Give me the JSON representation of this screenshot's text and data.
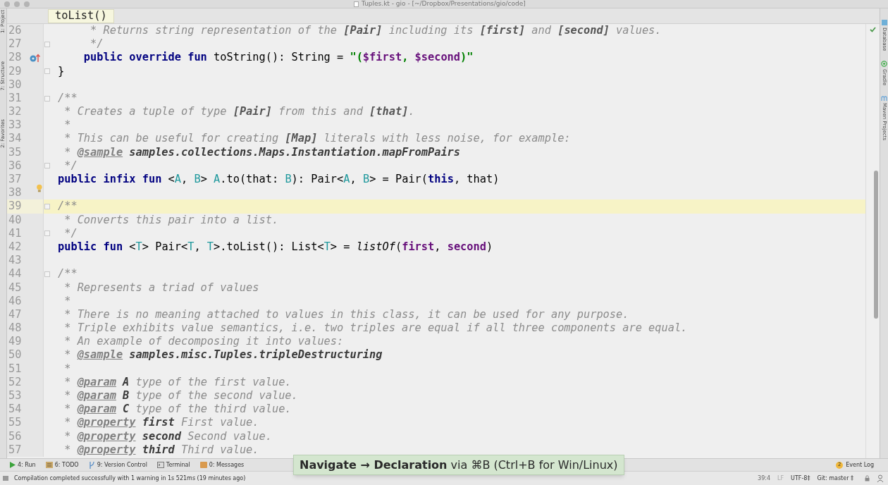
{
  "window": {
    "title": "Tuples.kt - gio - [~/Dropbox/Presentations/gio/code]"
  },
  "breadcrumb": {
    "label": "toList()"
  },
  "left_stripe": [
    {
      "label": "1: Project"
    },
    {
      "label": "7: Structure"
    },
    {
      "label": "2: Favorites"
    }
  ],
  "right_stripe": [
    {
      "label": "Database",
      "kind": "database"
    },
    {
      "label": "Gradle",
      "kind": "gradle"
    },
    {
      "label": "Maven Projects",
      "kind": "maven"
    }
  ],
  "editor": {
    "lines": [
      {
        "number": "26",
        "current": false,
        "tokens": [
          {
            "kind": "c",
            "t": "     * Returns string representation of the "
          },
          {
            "kind": "dref",
            "t": "[Pair]"
          },
          {
            "kind": "c",
            "t": " including its "
          },
          {
            "kind": "dref",
            "t": "[first]"
          },
          {
            "kind": "c",
            "t": " and "
          },
          {
            "kind": "dref",
            "t": "[second]"
          },
          {
            "kind": "c",
            "t": " values."
          }
        ]
      },
      {
        "number": "27",
        "current": false,
        "fold": true,
        "tokens": [
          {
            "kind": "c",
            "t": "     */"
          }
        ]
      },
      {
        "number": "28",
        "current": false,
        "override_marker": true,
        "tokens": [
          {
            "kind": "kw",
            "t": "    public override fun "
          },
          {
            "kind": "p",
            "t": "toString(): String = "
          },
          {
            "kind": "str",
            "t": "\"("
          },
          {
            "kind": "interp",
            "t": "$first"
          },
          {
            "kind": "str",
            "t": ", "
          },
          {
            "kind": "interp",
            "t": "$second"
          },
          {
            "kind": "str",
            "t": ")\""
          }
        ]
      },
      {
        "number": "29",
        "current": false,
        "fold": true,
        "tokens": [
          {
            "kind": "p",
            "t": "}"
          }
        ]
      },
      {
        "number": "30",
        "current": false
      },
      {
        "number": "31",
        "current": false,
        "fold": true,
        "tokens": [
          {
            "kind": "c",
            "t": "/**"
          }
        ]
      },
      {
        "number": "32",
        "current": false,
        "tokens": [
          {
            "kind": "c",
            "t": " * Creates a tuple of type "
          },
          {
            "kind": "dref",
            "t": "[Pair]"
          },
          {
            "kind": "c",
            "t": " from this and "
          },
          {
            "kind": "dref",
            "t": "[that]"
          },
          {
            "kind": "c",
            "t": "."
          }
        ]
      },
      {
        "number": "33",
        "current": false,
        "tokens": [
          {
            "kind": "c",
            "t": " *"
          }
        ]
      },
      {
        "number": "34",
        "current": false,
        "tokens": [
          {
            "kind": "c",
            "t": " * This can be useful for creating "
          },
          {
            "kind": "dref",
            "t": "[Map]"
          },
          {
            "kind": "c",
            "t": " literals with less noise, for example:"
          }
        ]
      },
      {
        "number": "35",
        "current": false,
        "tokens": [
          {
            "kind": "c",
            "t": " * "
          },
          {
            "kind": "tag",
            "t": "@sample"
          },
          {
            "kind": "dstrong",
            "t": " samples.collections.Maps.Instantiation.mapFromPairs"
          }
        ]
      },
      {
        "number": "36",
        "current": false,
        "fold": true,
        "tokens": [
          {
            "kind": "c",
            "t": " */"
          }
        ]
      },
      {
        "number": "37",
        "current": false,
        "tokens": [
          {
            "kind": "kw",
            "t": "public infix fun "
          },
          {
            "kind": "p",
            "t": "<"
          },
          {
            "kind": "tp",
            "t": "A"
          },
          {
            "kind": "p",
            "t": ", "
          },
          {
            "kind": "tp",
            "t": "B"
          },
          {
            "kind": "p",
            "t": "> "
          },
          {
            "kind": "tp",
            "t": "A"
          },
          {
            "kind": "p",
            "t": ".to(that: "
          },
          {
            "kind": "tp",
            "t": "B"
          },
          {
            "kind": "p",
            "t": "): Pair<"
          },
          {
            "kind": "tp",
            "t": "A"
          },
          {
            "kind": "p",
            "t": ", "
          },
          {
            "kind": "tp",
            "t": "B"
          },
          {
            "kind": "p",
            "t": "> = Pair("
          },
          {
            "kind": "kw",
            "t": "this"
          },
          {
            "kind": "p",
            "t": ", that)"
          }
        ]
      },
      {
        "number": "38",
        "current": false,
        "intention_bulb": true
      },
      {
        "number": "39",
        "current": true,
        "fold": true,
        "tokens": [
          {
            "kind": "c",
            "t": "/**"
          }
        ]
      },
      {
        "number": "40",
        "current": false,
        "tokens": [
          {
            "kind": "c",
            "t": " * Converts this pair into a list."
          }
        ]
      },
      {
        "number": "41",
        "current": false,
        "fold": true,
        "tokens": [
          {
            "kind": "c",
            "t": " */"
          }
        ]
      },
      {
        "number": "42",
        "current": false,
        "tokens": [
          {
            "kind": "kw",
            "t": "public fun "
          },
          {
            "kind": "p",
            "t": "<"
          },
          {
            "kind": "tp",
            "t": "T"
          },
          {
            "kind": "p",
            "t": "> Pair<"
          },
          {
            "kind": "tp",
            "t": "T"
          },
          {
            "kind": "p",
            "t": ", "
          },
          {
            "kind": "tp",
            "t": "T"
          },
          {
            "kind": "p",
            "t": ">.toList(): List<"
          },
          {
            "kind": "tp",
            "t": "T"
          },
          {
            "kind": "p",
            "t": "> = "
          },
          {
            "kind": "call",
            "t": "listOf"
          },
          {
            "kind": "p",
            "t": "("
          },
          {
            "kind": "prop",
            "t": "first"
          },
          {
            "kind": "p",
            "t": ", "
          },
          {
            "kind": "prop",
            "t": "second"
          },
          {
            "kind": "p",
            "t": ")"
          }
        ]
      },
      {
        "number": "43",
        "current": false
      },
      {
        "number": "44",
        "current": false,
        "fold": true,
        "tokens": [
          {
            "kind": "c",
            "t": "/**"
          }
        ]
      },
      {
        "number": "45",
        "current": false,
        "tokens": [
          {
            "kind": "c",
            "t": " * Represents a triad of values"
          }
        ]
      },
      {
        "number": "46",
        "current": false,
        "tokens": [
          {
            "kind": "c",
            "t": " *"
          }
        ]
      },
      {
        "number": "47",
        "current": false,
        "tokens": [
          {
            "kind": "c",
            "t": " * There is no meaning attached to values in this class, it can be used for any purpose."
          }
        ]
      },
      {
        "number": "48",
        "current": false,
        "tokens": [
          {
            "kind": "c",
            "t": " * Triple exhibits value semantics, i.e. two triples are equal if all three components are equal."
          }
        ]
      },
      {
        "number": "49",
        "current": false,
        "tokens": [
          {
            "kind": "c",
            "t": " * An example of decomposing it into values:"
          }
        ]
      },
      {
        "number": "50",
        "current": false,
        "tokens": [
          {
            "kind": "c",
            "t": " * "
          },
          {
            "kind": "tag",
            "t": "@sample"
          },
          {
            "kind": "dstrong",
            "t": " samples.misc.Tuples.tripleDestructuring"
          }
        ]
      },
      {
        "number": "51",
        "current": false,
        "tokens": [
          {
            "kind": "c",
            "t": " *"
          }
        ]
      },
      {
        "number": "52",
        "current": false,
        "tokens": [
          {
            "kind": "c",
            "t": " * "
          },
          {
            "kind": "tag",
            "t": "@param"
          },
          {
            "kind": "dstrong",
            "t": " A"
          },
          {
            "kind": "c",
            "t": " type of the first value."
          }
        ]
      },
      {
        "number": "53",
        "current": false,
        "tokens": [
          {
            "kind": "c",
            "t": " * "
          },
          {
            "kind": "tag",
            "t": "@param"
          },
          {
            "kind": "dstrong",
            "t": " B"
          },
          {
            "kind": "c",
            "t": " type of the second value."
          }
        ]
      },
      {
        "number": "54",
        "current": false,
        "tokens": [
          {
            "kind": "c",
            "t": " * "
          },
          {
            "kind": "tag",
            "t": "@param"
          },
          {
            "kind": "dstrong",
            "t": " C"
          },
          {
            "kind": "c",
            "t": " type of the third value."
          }
        ]
      },
      {
        "number": "55",
        "current": false,
        "tokens": [
          {
            "kind": "c",
            "t": " * "
          },
          {
            "kind": "tag",
            "t": "@property"
          },
          {
            "kind": "dstrong",
            "t": " first"
          },
          {
            "kind": "c",
            "t": " First value."
          }
        ]
      },
      {
        "number": "56",
        "current": false,
        "tokens": [
          {
            "kind": "c",
            "t": " * "
          },
          {
            "kind": "tag",
            "t": "@property"
          },
          {
            "kind": "dstrong",
            "t": " second"
          },
          {
            "kind": "c",
            "t": " Second value."
          }
        ]
      },
      {
        "number": "57",
        "current": false,
        "tokens": [
          {
            "kind": "c",
            "t": " * "
          },
          {
            "kind": "tag",
            "t": "@property"
          },
          {
            "kind": "dstrong",
            "t": " third"
          },
          {
            "kind": "c",
            "t": " Third value."
          }
        ]
      }
    ]
  },
  "tip": {
    "text": "**Navigate → Declaration** via ⌘B (Ctrl+B for Win/Linux)"
  },
  "tool_windows": [
    {
      "label": "4: Run",
      "kind": "run"
    },
    {
      "label": "6: TODO",
      "kind": "todo"
    },
    {
      "label": "9: Version Control",
      "kind": "vcs"
    },
    {
      "label": "Terminal",
      "kind": "terminal"
    },
    {
      "label": "0: Messages",
      "kind": "messages"
    }
  ],
  "event_log": {
    "badge": "2",
    "label": "Event Log"
  },
  "status_bar": {
    "message": "Compilation completed successfully with 1 warning in 1s 521ms (19 minutes ago)",
    "position": "39:4",
    "line_separator": "LF",
    "encoding": "UTF-8‡",
    "branch": "Git: master ‡"
  }
}
